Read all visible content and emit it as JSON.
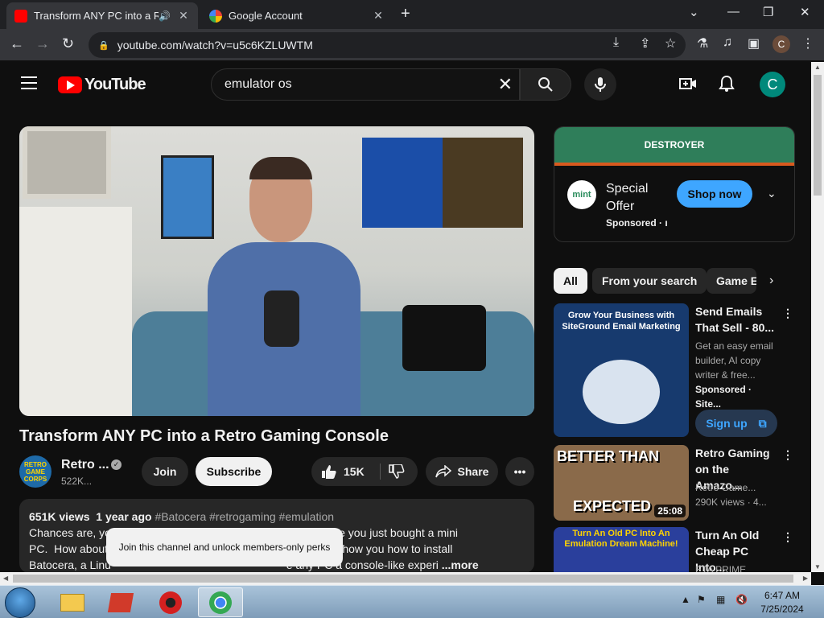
{
  "browser": {
    "tabs": [
      {
        "title": "Transform ANY PC into a Re",
        "active": true,
        "favicon": "youtube-icon"
      },
      {
        "title": "Google Account",
        "active": false,
        "favicon": "google-icon"
      }
    ],
    "url": "youtube.com/watch?v=u5c6KZLUWTM",
    "profile_initial": "C"
  },
  "youtube": {
    "logo_text": "YouTube",
    "search_query": "emulator os",
    "avatar_initial": "C"
  },
  "video": {
    "title": "Transform ANY PC into a Retro Gaming Console",
    "channel_name": "Retro ...",
    "channel_avatar_text": "RETRO GAME CORPS",
    "subscribers": "522K...",
    "join_label": "Join",
    "subscribe_label": "Subscribe",
    "likes": "15K",
    "share_label": "Share"
  },
  "description": {
    "views": "651K views",
    "age": "1 year ago",
    "tags": "#Batocera #retrogaming #emulation",
    "line1": "Chances are, yo                                                      e.  Or maybe you just bought a mini",
    "line2": "PC.  How about                                                           guide I'll show you how to install",
    "line3": "Batocera, a Linu                                                        e any PC a console-like experi",
    "more": "...more",
    "tooltip": "Join this channel and unlock members-only perks"
  },
  "ad": {
    "banner_text": "DESTROYER",
    "logo_text": "mint",
    "title": "Special Offer",
    "sponsored": "Sponsored · ı",
    "shop_label": "Shop now"
  },
  "chips": [
    "All",
    "From your search",
    "Game E"
  ],
  "recommendations": [
    {
      "thumb_text": "Grow Your Business with SiteGround Email Marketing",
      "title": "Send Emails That Sell - 80...",
      "sub1": "Get an easy email builder, AI copy writer & free...",
      "sub2": "Sponsored · Site...",
      "cta": "Sign up"
    },
    {
      "thumb_text_top": "BETTER THAN",
      "thumb_text_bottom": "EXPECTED",
      "duration": "25:08",
      "title": "Retro Gaming on the Amazo...",
      "channel": "Retro Game...",
      "meta": "290K views · 4..."
    },
    {
      "thumb_text": "Turn An Old PC Into An Emulation Dream Machine!",
      "title": "Turn An Old Cheap PC Into...",
      "channel": "ETA PRIME"
    }
  ],
  "taskbar": {
    "time": "6:47 AM",
    "date": "7/25/2024"
  },
  "colors": {
    "accent": "#3ea6ff",
    "yt_red": "#ff0000",
    "background": "#0f0f0f"
  }
}
